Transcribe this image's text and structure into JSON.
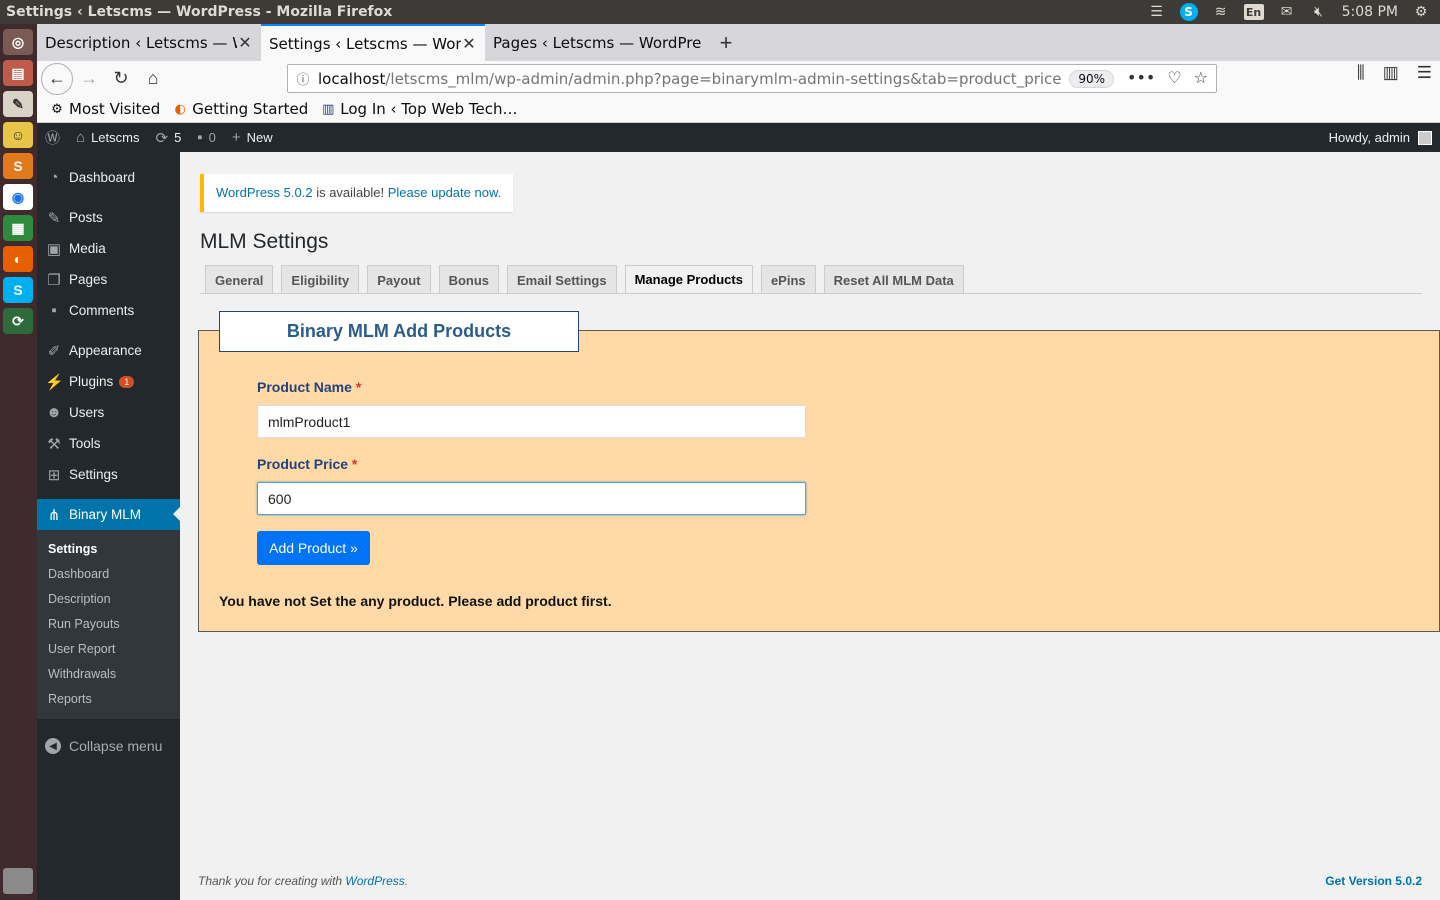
{
  "os": {
    "window_title": "Settings ‹ Letscms — WordPress - Mozilla Firefox",
    "lang": "En",
    "time": "5:08 PM"
  },
  "browser": {
    "tabs": [
      {
        "label": "Description ‹ Letscms — Wo"
      },
      {
        "label": "Settings ‹ Letscms — WordP"
      },
      {
        "label": "Pages ‹ Letscms — WordPre"
      }
    ],
    "url_host": "localhost",
    "url_path": "/letscms_mlm/wp-admin/admin.php?page=binarymlm-admin-settings&tab=product_price",
    "zoom": "90%",
    "bookmarks": [
      "Most Visited",
      "Getting Started",
      "Log In ‹ Top Web Tech…"
    ]
  },
  "adminbar": {
    "site_name": "Letscms",
    "updates_count": "5",
    "comments_count": "0",
    "new_label": "New",
    "howdy": "Howdy, admin"
  },
  "sidebar": {
    "items": [
      {
        "label": "Dashboard"
      },
      {
        "label": "Posts"
      },
      {
        "label": "Media"
      },
      {
        "label": "Pages"
      },
      {
        "label": "Comments"
      },
      {
        "label": "Appearance"
      },
      {
        "label": "Plugins",
        "badge": "1"
      },
      {
        "label": "Users"
      },
      {
        "label": "Tools"
      },
      {
        "label": "Settings"
      },
      {
        "label": "Binary MLM"
      }
    ],
    "submenu": [
      "Settings",
      "Dashboard",
      "Description",
      "Run Payouts",
      "User Report",
      "Withdrawals",
      "Reports"
    ],
    "collapse_label": "Collapse menu"
  },
  "notice": {
    "version_link": "WordPress 5.0.2",
    "middle_text": " is available! ",
    "update_link": "Please update now."
  },
  "page": {
    "title": "MLM Settings",
    "tabs": [
      "General",
      "Eligibility",
      "Payout",
      "Bonus",
      "Email Settings",
      "Manage Products",
      "ePins",
      "Reset All MLM Data"
    ],
    "active_tab": "Manage Products"
  },
  "form": {
    "legend": "Binary MLM Add Products",
    "product_name_label": "Product Name",
    "product_name_value": "mlmProduct1",
    "product_price_label": "Product Price",
    "product_price_value": "600",
    "required_mark": "*",
    "submit_label": "Add Product »",
    "message": "You have not Set the any product. Please add product first."
  },
  "footer": {
    "text": "Thank you for creating with ",
    "link": "WordPress",
    "text_end": ".",
    "version": "Get Version 5.0.2"
  }
}
